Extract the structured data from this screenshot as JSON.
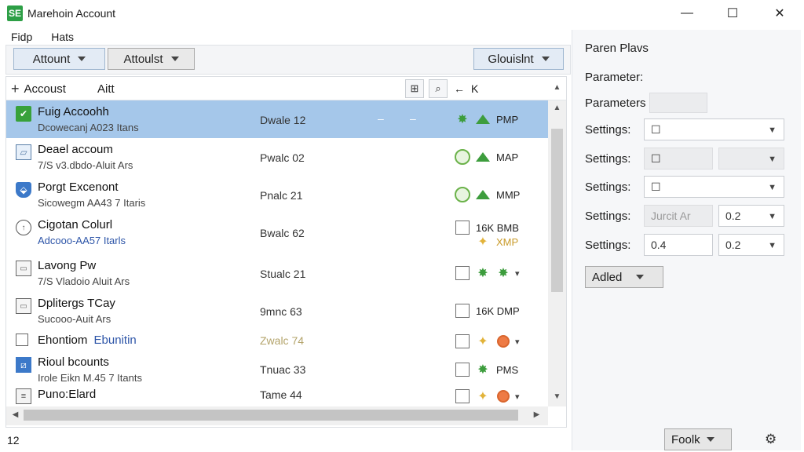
{
  "window": {
    "title": "Marehoin Account",
    "app_icon_glyph": "SE",
    "controls": {
      "minimize": "—",
      "maximize": "☐",
      "close": "✕"
    }
  },
  "menu": [
    "Fidp",
    "Hats"
  ],
  "toolbar": {
    "left1": "Attount",
    "left2": "Attoulst",
    "right": "Glouislnt"
  },
  "list": {
    "add_label": "Accoust",
    "alt_label": "Aitt",
    "tools_k": "K",
    "rows": [
      {
        "icon": "check-green-icon",
        "title": "Fuig Accoohh",
        "sub": "Dcowecanj A023 Itans",
        "mid": "Dwale 12",
        "dash": "–",
        "actions": [
          "green-star",
          "green-up"
        ],
        "act_text": "PMP",
        "selected": true
      },
      {
        "icon": "image-icon",
        "title": "Deael accoum",
        "sub": "7/S v3.dbdo-Aluit Ars",
        "mid": "Pwalc 02",
        "actions": [
          "green-circle",
          "green-up"
        ],
        "act_text": "MAP"
      },
      {
        "icon": "shield-icon",
        "title": "Porgt Excenont",
        "sub": "Sicowegm AA43 7 Itaris",
        "mid": "Pnalc 21",
        "actions": [
          "green-circle",
          "green-up"
        ],
        "act_text": "MMP"
      },
      {
        "icon": "clock-icon",
        "title": "Cigotan Colurl",
        "sub": "Adcooo-AA57 Itarls",
        "sub_blue": true,
        "mid": "Bwalc 62",
        "actions": [
          "checkbox"
        ],
        "act_text": "16K BMB",
        "act_text2": "XMP"
      },
      {
        "icon": "folder-icon",
        "title": "Lavong Pw",
        "sub": "7/S Vladoio Aluit Ars",
        "mid": "Stualc 21",
        "actions": [
          "checkbox",
          "green-star",
          "green-star"
        ],
        "chevron": true
      },
      {
        "icon": "folder-icon",
        "title": "Dplitergs TCay",
        "sub": "Sucooo-Auit Ars",
        "mid": "9mnc 63",
        "actions": [
          "checkbox"
        ],
        "act_text": "16K DMP"
      },
      {
        "icon": "blank-icon",
        "title": "Ehontiom",
        "title_blue": "Ebunitin",
        "mid": "Zwalc 74",
        "actions": [
          "checkbox",
          "yellow-star",
          "orange-circle"
        ],
        "chevron": true
      },
      {
        "icon": "blue-box-icon",
        "title": "Rioul bcounts",
        "sub": "Irole Eikn M.45 7 Itants",
        "mid": "Tnuac 33",
        "actions": [
          "checkbox",
          "green-star"
        ],
        "act_text": "PMS"
      },
      {
        "icon": "document-icon",
        "title": "Puno:Elard",
        "mid": "Tame 44",
        "actions": [
          "checkbox",
          "yellow-star",
          "orange-circle"
        ],
        "chevron": true
      }
    ]
  },
  "right_panel": {
    "title": "Paren Plavs",
    "param1_label": "Parameter:",
    "param2_label": "Parameters",
    "settings": [
      {
        "label": "Settings:",
        "field1": "☐"
      },
      {
        "label": "Settings:",
        "field1": "☐"
      },
      {
        "label": "Settings:",
        "field1": "☐"
      },
      {
        "label": "Settings:",
        "field1": "Jurcit Ar",
        "field2": "0.2"
      },
      {
        "label": "Settings:",
        "field1": "0.4",
        "field2": "0.2"
      }
    ],
    "add_button": "Adled"
  },
  "status": {
    "count": "12",
    "footer_button": "Foolk"
  }
}
